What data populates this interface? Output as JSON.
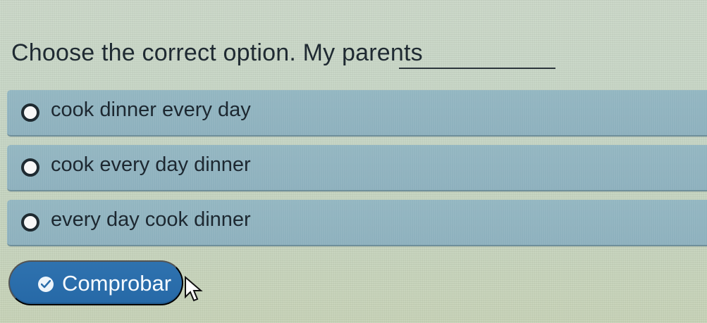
{
  "question": {
    "text": "Choose the correct option. My parents"
  },
  "options": [
    {
      "label": "cook dinner every day"
    },
    {
      "label": "cook every day dinner"
    },
    {
      "label": "every day cook dinner"
    }
  ],
  "button": {
    "label": "Comprobar"
  },
  "icons": {
    "radio": "radio-button-icon",
    "check": "check-circle-icon",
    "cursor": "pointer-cursor-icon"
  },
  "colors": {
    "background": "#c8d6c6",
    "option_background": "#8fb2be",
    "button_background": "#2c6eaa",
    "text": "#1f2a32",
    "button_text": "#f7fbff"
  }
}
